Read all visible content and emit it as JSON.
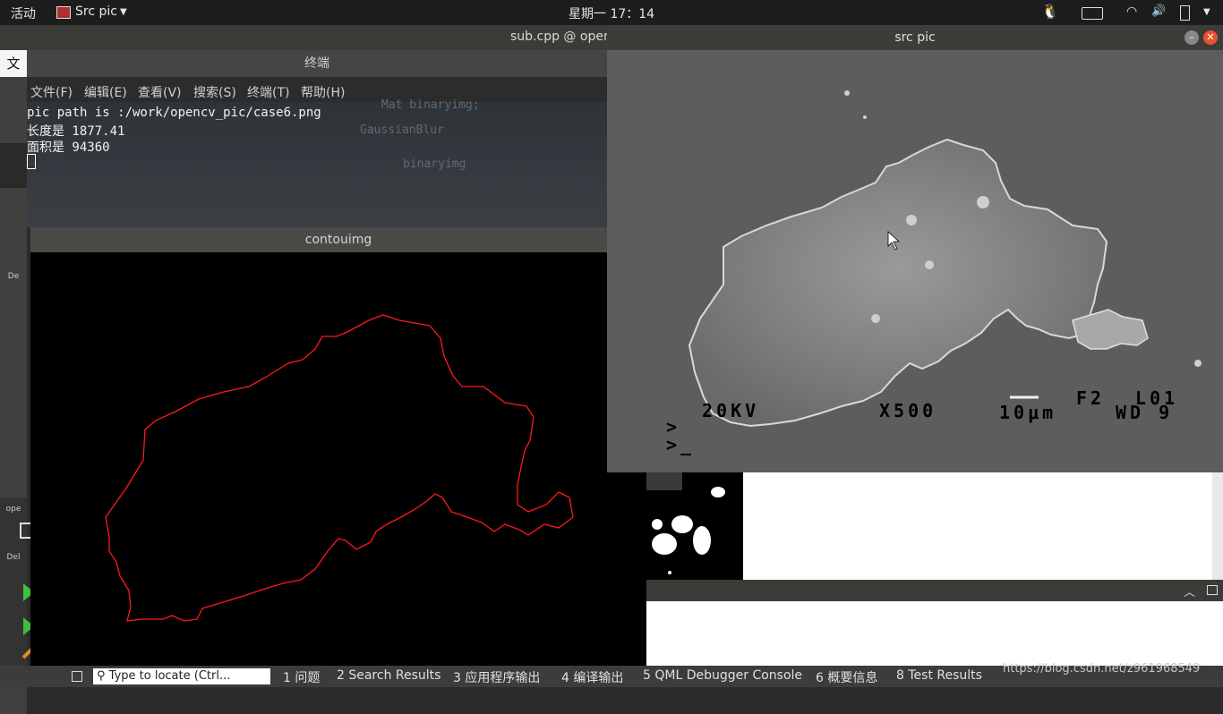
{
  "topbar": {
    "activities": "活动",
    "app_name": "Src pic",
    "clock": "星期一 17：14"
  },
  "qtcreator": {
    "title": "sub.cpp @ oper",
    "left_letter": "文",
    "modes": [
      "De",
      "ope",
      "Del"
    ]
  },
  "terminal": {
    "title": "终端",
    "menu": [
      "文件(F)",
      "编辑(E)",
      "查看(V)",
      "搜索(S)",
      "终端(T)",
      "帮助(H)"
    ],
    "lines": [
      "pic path is :/work/opencv_pic/case6.png",
      "长度是 1877.41",
      "面积是 94360"
    ],
    "ghost_code": [
      "Mat binaryimg;",
      "GaussianBlur",
      "binaryimg"
    ]
  },
  "contour": {
    "title": "contouimg",
    "stroke_color": "#ff1a1a"
  },
  "srcpic": {
    "title": "src pic",
    "overlay_texts": {
      "kv": "20KV",
      "mag": "X500",
      "scale": "10μm",
      "f2": "F2",
      "l01": "L01",
      "wd": "WD 9",
      "prompt1": ">",
      "prompt2": ">_"
    }
  },
  "statusbar": {
    "locate_placeholder": "Type to locate (Ctrl...",
    "tabs": [
      "1 问题",
      "2 Search Results",
      "3 应用程序输出",
      "4 编译输出",
      "5 QML Debugger Console",
      "6 概要信息",
      "8 Test Results"
    ]
  },
  "watermark": "https://blog.csdn.net/z961968549"
}
